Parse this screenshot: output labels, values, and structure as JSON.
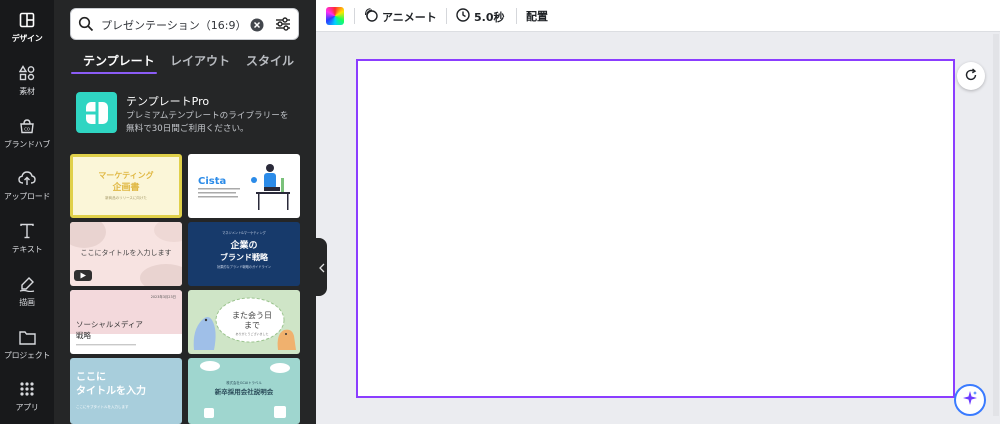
{
  "rail": {
    "items": [
      {
        "label": "デザイン",
        "icon": "layout-icon"
      },
      {
        "label": "素材",
        "icon": "shapes-icon"
      },
      {
        "label": "ブランドハブ",
        "icon": "brand-icon"
      },
      {
        "label": "アップロード",
        "icon": "cloud-upload-icon"
      },
      {
        "label": "テキスト",
        "icon": "text-icon"
      },
      {
        "label": "描画",
        "icon": "draw-icon"
      },
      {
        "label": "プロジェクト",
        "icon": "folder-icon"
      },
      {
        "label": "アプリ",
        "icon": "apps-icon"
      }
    ]
  },
  "panel": {
    "search": {
      "value": "プレゼンテーション（16:9）"
    },
    "tabs": [
      "テンプレート",
      "レイアウト",
      "スタイル"
    ],
    "promo": {
      "title": "テンプレートPro",
      "desc": "プレミアムテンプレートのライブラリーを無料で30日間ご利用ください。"
    },
    "templates": [
      {
        "title": "マーケティング",
        "title2": "企画書",
        "sub": "新商品のリリースに向けた",
        "accent": "#e0d04a"
      },
      {
        "title": "Cista",
        "accent": "#2b8be8"
      },
      {
        "title": "ここにタイトルを入力します"
      },
      {
        "title": "企業の",
        "title2": "ブランド戦略",
        "top": "マネジメント&マーケティング",
        "sub": "効果的なブランド戦略のガイドライン"
      },
      {
        "title": "ソーシャルメディア",
        "title2": "戦略",
        "date": "2023年3月23日"
      },
      {
        "title": "また会う日",
        "title2": "まで",
        "sub": "ありがとうございました"
      },
      {
        "title": "ここに",
        "title2": "タイトルを入力",
        "sub": "ここにサブタイトルを入力します"
      },
      {
        "title": "新卒採用会社説明会",
        "top": "株式会社GCAIトラベル"
      }
    ]
  },
  "topbar": {
    "animate_label": "アニメート",
    "duration_label": "5.0秒",
    "position_label": "配置"
  },
  "colors": {
    "accent_purple": "#8b3dff",
    "rail_bg": "#18191b",
    "panel_bg": "#252627",
    "canvas_bg": "#ebecf0",
    "promo_teal": "#2fd5c2"
  }
}
